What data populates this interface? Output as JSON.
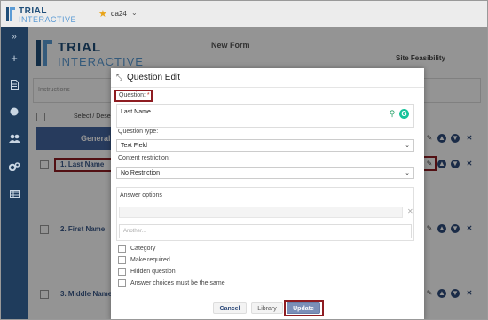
{
  "app": {
    "logo_line1": "TRIAL",
    "logo_line2": "INTERACTIVE",
    "user": "qa24"
  },
  "sidebar": {
    "items": [
      {
        "icon": "double-chevron-right-icon"
      },
      {
        "icon": "plus-icon"
      },
      {
        "icon": "document-icon"
      },
      {
        "icon": "circle-icon"
      },
      {
        "icon": "users-icon"
      },
      {
        "icon": "gears-icon"
      },
      {
        "icon": "table-icon"
      }
    ]
  },
  "page": {
    "form_title": "New Form",
    "site_title": "Site Feasibility",
    "instructions_placeholder": "Instructions",
    "select_label": "Select / Dese",
    "section_label": "General",
    "questions": [
      "1. Last Name",
      "2. First Name",
      "3. Middle Name"
    ]
  },
  "modal": {
    "title": "Question Edit",
    "question_label": "Question:",
    "required_mark": "*",
    "question_value": "Last Name",
    "question_type_label": "Question type:",
    "question_type_value": "Text Field",
    "content_restriction_label": "Content restriction:",
    "content_restriction_value": "No Restriction",
    "answer_options_label": "Answer options",
    "another_placeholder": "Another...",
    "checkboxes": [
      "Category",
      "Make required",
      "Hidden question",
      "Answer choices must be the same"
    ],
    "buttons": {
      "cancel": "Cancel",
      "library": "Library",
      "update": "Update"
    }
  },
  "colors": {
    "sidebar": "#1f3c5c",
    "section_bar": "#4467a1",
    "highlight": "#8e1c21",
    "update_button": "#7b8fb8"
  }
}
